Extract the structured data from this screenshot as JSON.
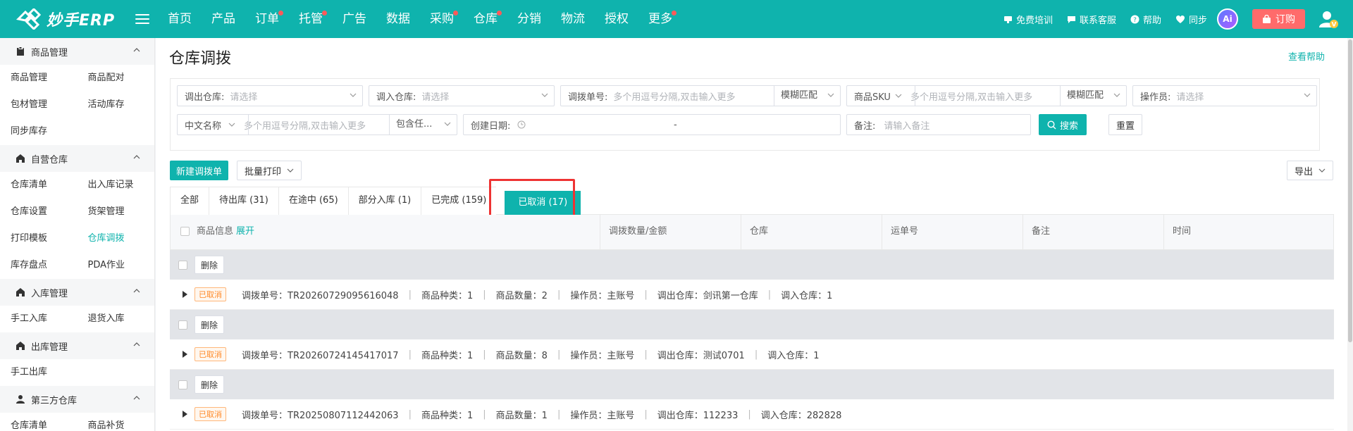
{
  "brand": {
    "name": "妙手ERP"
  },
  "nav": [
    {
      "label": "首页",
      "dot": false
    },
    {
      "label": "产品",
      "dot": false
    },
    {
      "label": "订单",
      "dot": true
    },
    {
      "label": "托管",
      "dot": true
    },
    {
      "label": "广告",
      "dot": false
    },
    {
      "label": "数据",
      "dot": false
    },
    {
      "label": "采购",
      "dot": true
    },
    {
      "label": "仓库",
      "dot": true
    },
    {
      "label": "分销",
      "dot": false
    },
    {
      "label": "物流",
      "dot": false
    },
    {
      "label": "授权",
      "dot": false
    },
    {
      "label": "更多",
      "dot": true
    }
  ],
  "top_right": {
    "training": "免费培训",
    "contact": "联系客服",
    "help": "帮助",
    "sync": "同步",
    "ai": "Ai",
    "order": "订购"
  },
  "sidebar": {
    "groups": [
      {
        "title": "商品管理",
        "items": [
          "商品管理",
          "商品配对",
          "包材管理",
          "活动库存",
          "同步库存"
        ]
      },
      {
        "title": "自营仓库",
        "items": [
          "仓库清单",
          "出入库记录",
          "仓库设置",
          "货架管理",
          "打印模板",
          "仓库调拨",
          "库存盘点",
          "PDA作业"
        ]
      },
      {
        "title": "入库管理",
        "items": [
          "手工入库",
          "退货入库"
        ]
      },
      {
        "title": "出库管理",
        "items": [
          "手工出库"
        ]
      },
      {
        "title": "第三方仓库",
        "items": [
          "仓库清单",
          "商品补货"
        ]
      }
    ],
    "active": "仓库调拨"
  },
  "page": {
    "title": "仓库调拨",
    "help_link": "查看帮助"
  },
  "filters": {
    "out_wh_label": "调出仓库:",
    "out_wh_ph": "请选择",
    "in_wh_label": "调入仓库:",
    "in_wh_ph": "请选择",
    "transfer_no_label": "调拨单号:",
    "transfer_no_ph": "多个用逗号分隔,双击输入更多",
    "transfer_no_mode": "模糊匹配",
    "sku_label": "商品SKU",
    "sku_ph": "多个用逗号分隔,双击输入更多",
    "sku_mode": "模糊匹配",
    "operator_label": "操作员:",
    "operator_ph": "请选择",
    "cn_name_label": "中文名称",
    "cn_name_ph": "多个用逗号分隔,双击输入更多",
    "cn_name_mode": "包含任...",
    "created_label": "创建日期:",
    "created_dash": "-",
    "remark_label": "备注:",
    "remark_ph": "请输入备注",
    "search": "搜索",
    "reset": "重置"
  },
  "toolbar": {
    "new": "新建调拨单",
    "batch_print": "批量打印",
    "export": "导出"
  },
  "tabs": [
    "全部",
    "待出库 (31)",
    "在途中 (65)",
    "部分入库 (1)",
    "已完成 (159)",
    "已取消 (17)"
  ],
  "active_tab": "已取消 (17)",
  "table": {
    "headers": {
      "product": "商品信息",
      "expand": "展开",
      "qty": "调拨数量/金额",
      "wh": "仓库",
      "waybill": "运单号",
      "remark": "备注",
      "time": "时间"
    },
    "delete_label": "删除",
    "rows": [
      {
        "status": "已取消",
        "no": "调拨单号：TR20260729095616048",
        "kinds": "商品种类：1",
        "qty": "商品数量：2",
        "op": "操作员：主账号",
        "out": "调出仓库：剑讯第一仓库",
        "in": "调入仓库：1"
      },
      {
        "status": "已取消",
        "no": "调拨单号：TR20260724145417017",
        "kinds": "商品种类：1",
        "qty": "商品数量：8",
        "op": "操作员：主账号",
        "out": "调出仓库：测试0701",
        "in": "调入仓库：1"
      },
      {
        "status": "已取消",
        "no": "调拨单号：TR20250807112442063",
        "kinds": "商品种类：1",
        "qty": "商品数量：1",
        "op": "操作员：主账号",
        "out": "调出仓库：112233",
        "in": "调入仓库：282828"
      }
    ]
  },
  "colors": {
    "brand": "#0fb3ad",
    "danger": "#ff6b6b",
    "cancel_badge": "#ff8a2a",
    "highlight": "#ee3333"
  }
}
